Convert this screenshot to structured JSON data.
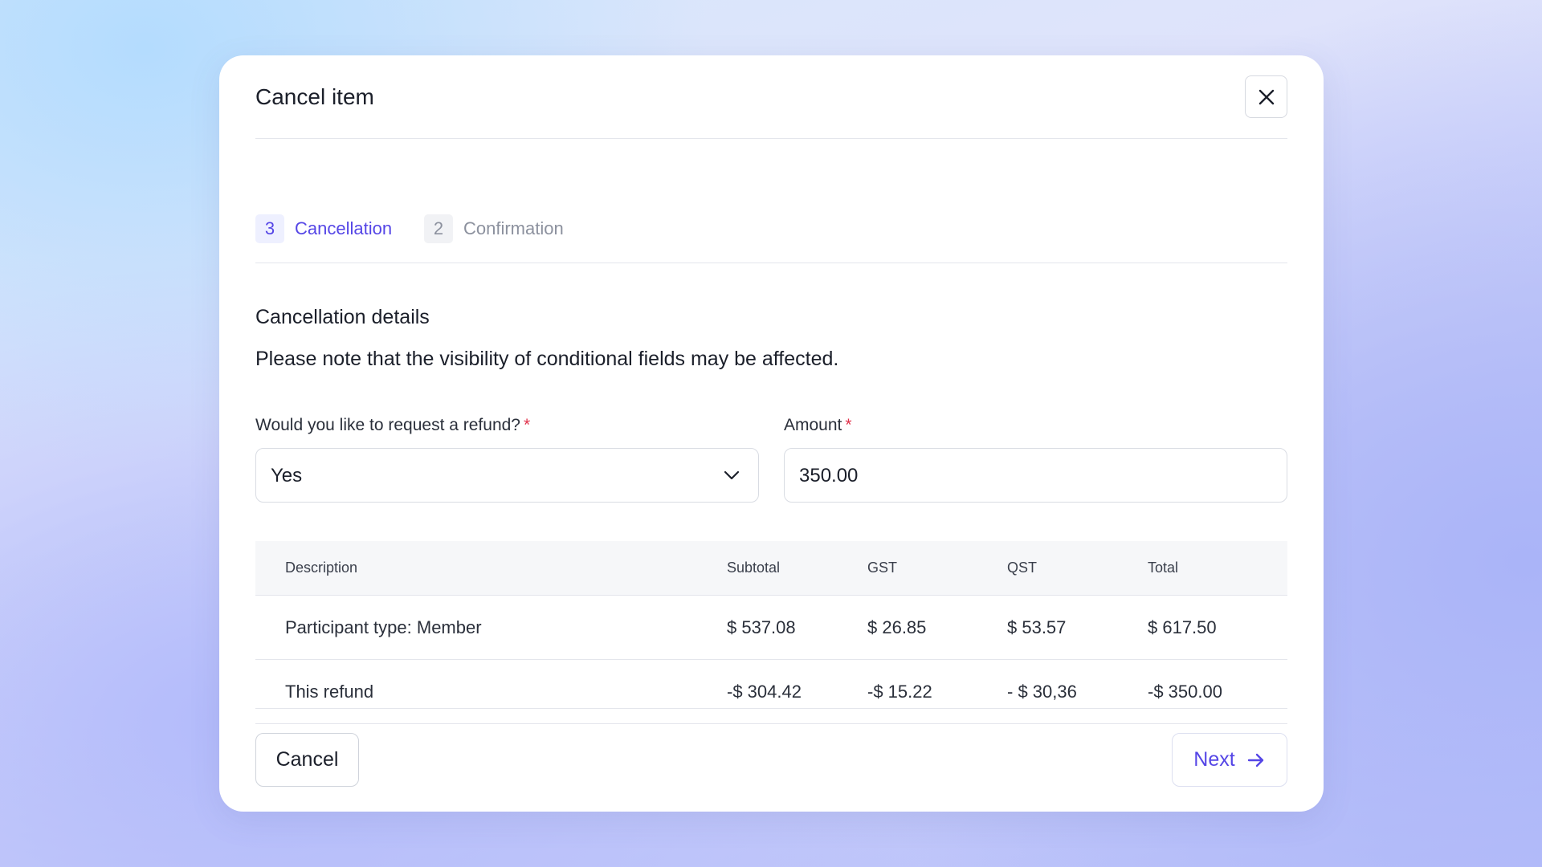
{
  "modal": {
    "title": "Cancel item",
    "close_icon": "close-icon"
  },
  "steps": [
    {
      "number": "3",
      "label": "Cancellation",
      "state": "active"
    },
    {
      "number": "2",
      "label": "Confirmation",
      "state": "inactive"
    }
  ],
  "section": {
    "title": "Cancellation details",
    "note": "Please note that the visibility of conditional fields may be affected."
  },
  "form": {
    "refund": {
      "label": "Would you like to request a refund?",
      "required_mark": "*",
      "value": "Yes",
      "icon": "chevron-down-icon"
    },
    "amount": {
      "label": "Amount",
      "required_mark": "*",
      "value": "350.00"
    }
  },
  "table": {
    "headers": [
      "Description",
      "Subtotal",
      "GST",
      "QST",
      "Total"
    ],
    "rows": [
      [
        "Participant type: Member",
        "$ 537.08",
        "$ 26.85",
        "$ 53.57",
        "$ 617.50"
      ],
      [
        "This refund",
        "-$ 304.42",
        "-$ 15.22",
        "- $ 30,36",
        "-$ 350.00"
      ]
    ]
  },
  "footer": {
    "cancel_label": "Cancel",
    "next_label": "Next",
    "next_icon": "arrow-right-icon"
  },
  "colors": {
    "accent": "#5546e6",
    "required": "#e0324b",
    "border": "#d9dce3"
  }
}
